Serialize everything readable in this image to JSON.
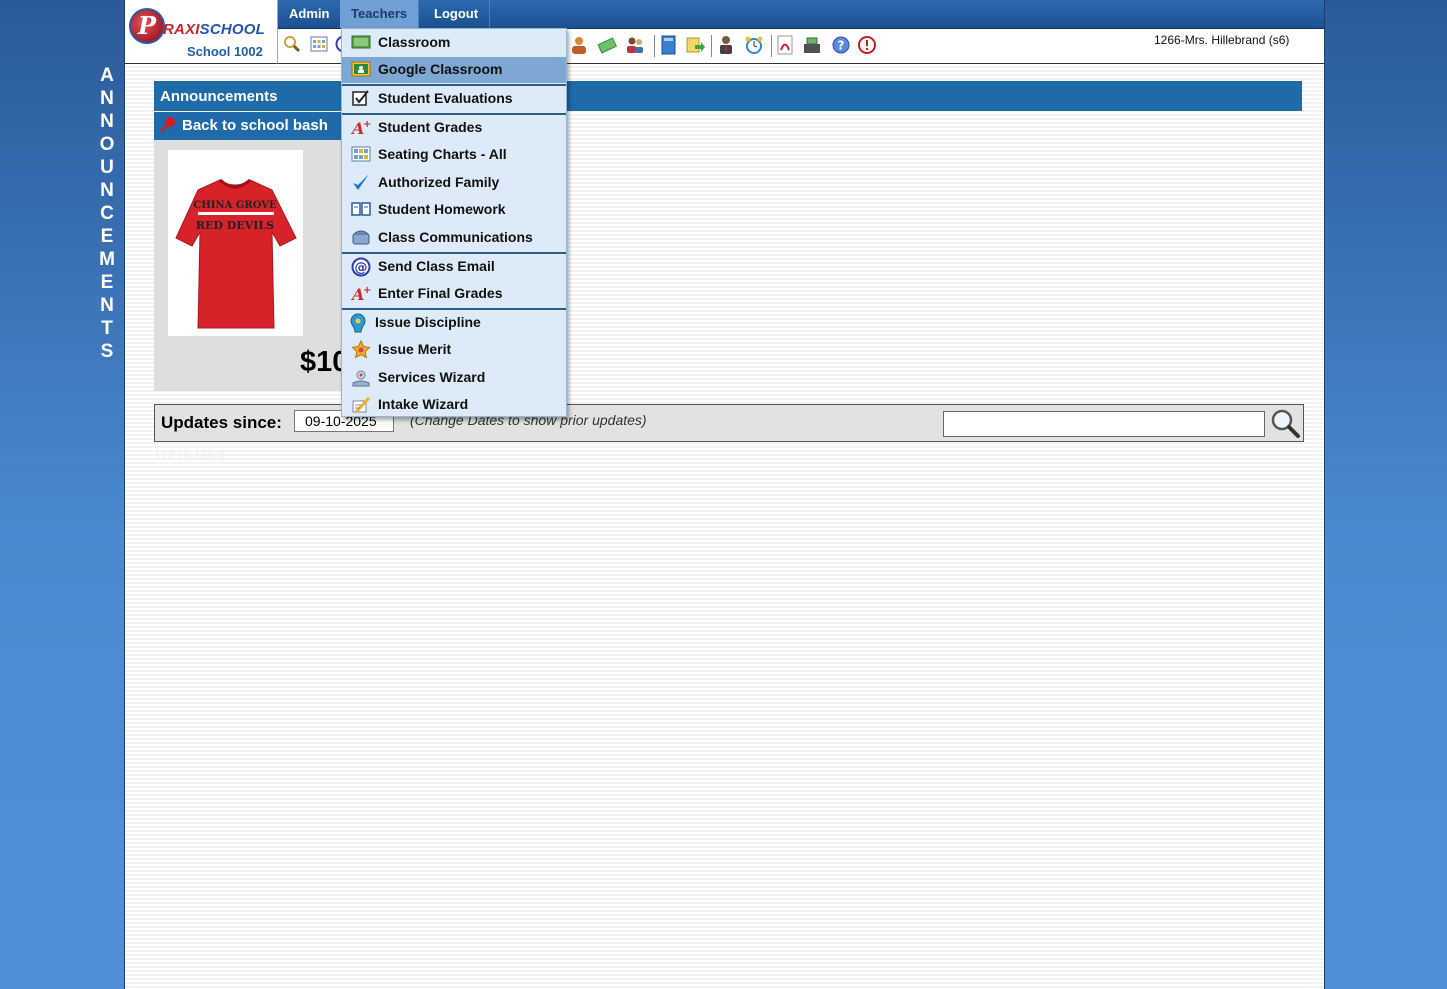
{
  "side_label": [
    "A",
    "N",
    "N",
    "O",
    "U",
    "N",
    "C",
    "E",
    "M",
    "E",
    "N",
    "T",
    "S"
  ],
  "logo": {
    "brand_first": "P",
    "brand_a": "RAXI",
    "brand_b": "SCHOOL",
    "school": "School 1002"
  },
  "nav": {
    "admin": "Admin",
    "teachers": "Teachers",
    "logout": "Logout"
  },
  "user": "1266-Mrs. Hillebrand (s6)",
  "announcements": {
    "header": "Announcements",
    "item": "Back to school bash",
    "shirt_line1": "CHINA GROVE",
    "shirt_line2": "RED DEVILS",
    "price": "$10"
  },
  "updates": {
    "label": "Updates since:",
    "date": "09-10-2025",
    "hint": "(Change Dates to show prior updates)",
    "search_placeholder": ""
  },
  "faint_ip": "172.16.156.3",
  "dropdown": [
    {
      "label": "Classroom",
      "icon": "classroom-icon"
    },
    {
      "label": "Google Classroom",
      "icon": "google-classroom-icon"
    },
    {
      "label": "Student Evaluations",
      "icon": "checkbox-icon"
    },
    {
      "label": "Student Grades",
      "icon": "grade-a-plus-icon"
    },
    {
      "label": "Seating Charts - All",
      "icon": "seating-chart-icon"
    },
    {
      "label": "Authorized Family",
      "icon": "checkmark-icon"
    },
    {
      "label": "Student Homework",
      "icon": "book-icon"
    },
    {
      "label": "Class Communications",
      "icon": "phone-icon"
    },
    {
      "label": "Send Class Email",
      "icon": "at-sign-icon"
    },
    {
      "label": "Enter Final Grades",
      "icon": "grade-a-plus-icon"
    },
    {
      "label": "Issue Discipline",
      "icon": "discipline-icon"
    },
    {
      "label": "Issue Merit",
      "icon": "merit-star-icon"
    },
    {
      "label": "Services Wizard",
      "icon": "services-icon"
    },
    {
      "label": "Intake Wizard",
      "icon": "intake-icon"
    }
  ],
  "colors": {
    "nav_bg": "#1c508f",
    "header_bg": "#1f6aa8",
    "menu_bg": "#ddeaf7",
    "menu_highlight": "#7fa7d3"
  }
}
